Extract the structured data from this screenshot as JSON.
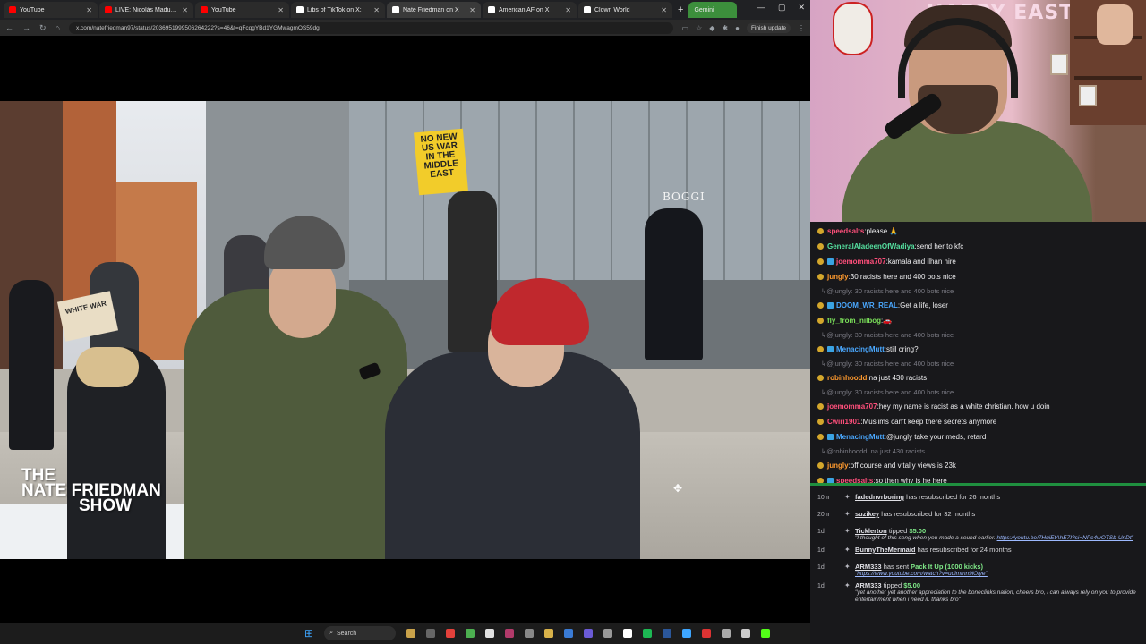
{
  "browser": {
    "tabs": [
      {
        "title": "YouTube",
        "color": "#ff0000"
      },
      {
        "title": "LIVE: Nicolás Maduro app",
        "color": "#ff0000"
      },
      {
        "title": "YouTube",
        "color": "#ff0000"
      },
      {
        "title": "Libs of TikTok on X:",
        "color": "#ffffff"
      },
      {
        "title": "Nate Friedman on X",
        "color": "#ffffff"
      },
      {
        "title": "American AF on X",
        "color": "#ffffff"
      },
      {
        "title": "Clown World",
        "color": "#ffffff"
      }
    ],
    "gemini_tab": "Gemini",
    "url": "x.com/natefriedman97/status/2036951999506264222?s=46&t=qFcqgYBd1YGMwagmOS59dg",
    "finish_update": "Finish update"
  },
  "video": {
    "protest_sign": [
      "NO NEW",
      "US WAR",
      "IN THE",
      "MIDDLE EAST"
    ],
    "small_sign": "WHITE WAR",
    "store_logo": "BOGGI",
    "show_logo": [
      "THE",
      "NATE FRIEDMAN",
      "SHOW"
    ]
  },
  "webcam": {
    "wall_text": "HAPPY EAST"
  },
  "chat": {
    "messages": [
      {
        "user": "speedsalts",
        "user_color": "#ff4f7b",
        "text": "please 🙏",
        "reply": false
      },
      {
        "user": "GeneralAladeenOfWadiya",
        "user_color": "#55e0a0",
        "text": "send her to kfc",
        "reply": false
      },
      {
        "user": "joemomma707",
        "user_color": "#ff4f7b",
        "text": "kamala and ilhan hire",
        "reply": false
      },
      {
        "user": "jungly",
        "user_color": "#ff9a2e",
        "text": "30 racists here and 400 bots nice",
        "reply": false
      },
      {
        "user": "",
        "user_color": "#7b7b84",
        "text": "@jungly: 30 racists here and 400 bots nice",
        "reply": true
      },
      {
        "user": "DOOM_WR_REAL",
        "user_color": "#4aa8ff",
        "text": "Get a life, loser",
        "reply": false
      },
      {
        "user": "fly_from_nilbog",
        "user_color": "#7be05a",
        "text": "🚗",
        "reply": false
      },
      {
        "user": "",
        "user_color": "#7b7b84",
        "text": "@jungly: 30 racists here and 400 bots nice",
        "reply": true
      },
      {
        "user": "MenacingMutt",
        "user_color": "#4aa8ff",
        "text": "still cring?",
        "reply": false
      },
      {
        "user": "",
        "user_color": "#7b7b84",
        "text": "@jungly: 30 racists here and 400 bots nice",
        "reply": true
      },
      {
        "user": "robinhoodd",
        "user_color": "#ff9a2e",
        "text": "na just 430 racists",
        "reply": false
      },
      {
        "user": "",
        "user_color": "#7b7b84",
        "text": "@jungly: 30 racists here and 400 bots nice",
        "reply": true
      },
      {
        "user": "joemomma707",
        "user_color": "#ff4f7b",
        "text": "hey my name is racist as a white christian. how u doin",
        "reply": false
      },
      {
        "user": "Cwiri1901",
        "user_color": "#ff4f7b",
        "text": "Muslims can't keep there secrets anymore",
        "reply": false
      },
      {
        "user": "MenacingMutt",
        "user_color": "#4aa8ff",
        "text": "@jungly take your meds, retard",
        "reply": false
      },
      {
        "user": "",
        "user_color": "#7b7b84",
        "text": "@robinhoodd: na just 430 racists",
        "reply": true
      },
      {
        "user": "jungly",
        "user_color": "#ff9a2e",
        "text": "off course and vitally views is 23k",
        "reply": false
      },
      {
        "user": "speedsalts",
        "user_color": "#ff4f7b",
        "text": "so then why is he here",
        "reply": false
      }
    ]
  },
  "feed": {
    "items": [
      {
        "age": "10hr",
        "user": "fadednvrboring",
        "text": "has resubscribed for 26 months",
        "amount": "",
        "note": "",
        "link": ""
      },
      {
        "age": "20hr",
        "user": "suzikey",
        "text": "has resubscribed for 32 months",
        "amount": "",
        "note": "",
        "link": ""
      },
      {
        "age": "1d",
        "user": "Ticklerton",
        "text": "tipped",
        "amount": "$5.00",
        "note": "\"I thought of this song when you made a sound earlier.",
        "link": "https://youtu.be/7HqiEtAhE7I?si=NPc4wOTSb-UnDt\""
      },
      {
        "age": "1d",
        "user": "BunnyTheMermaid",
        "text": "has resubscribed for 24 months",
        "amount": "",
        "note": "",
        "link": ""
      },
      {
        "age": "1d",
        "user": "ARM333",
        "text": "has sent",
        "amount": "Pack It Up (1000 kicks)",
        "note": "",
        "link": "\"https://www.youtube.com/watch?v=udlmmn9lOiye\""
      },
      {
        "age": "1d",
        "user": "ARM333",
        "text": "tipped",
        "amount": "$5.00",
        "note": "\"yet another yet another appreciation to the boneclinks nation, cheers bro, i can always rely on you to provide entertainment when i need it. thanks bro\"",
        "link": ""
      }
    ]
  },
  "taskbar": {
    "search_label": "Search"
  }
}
